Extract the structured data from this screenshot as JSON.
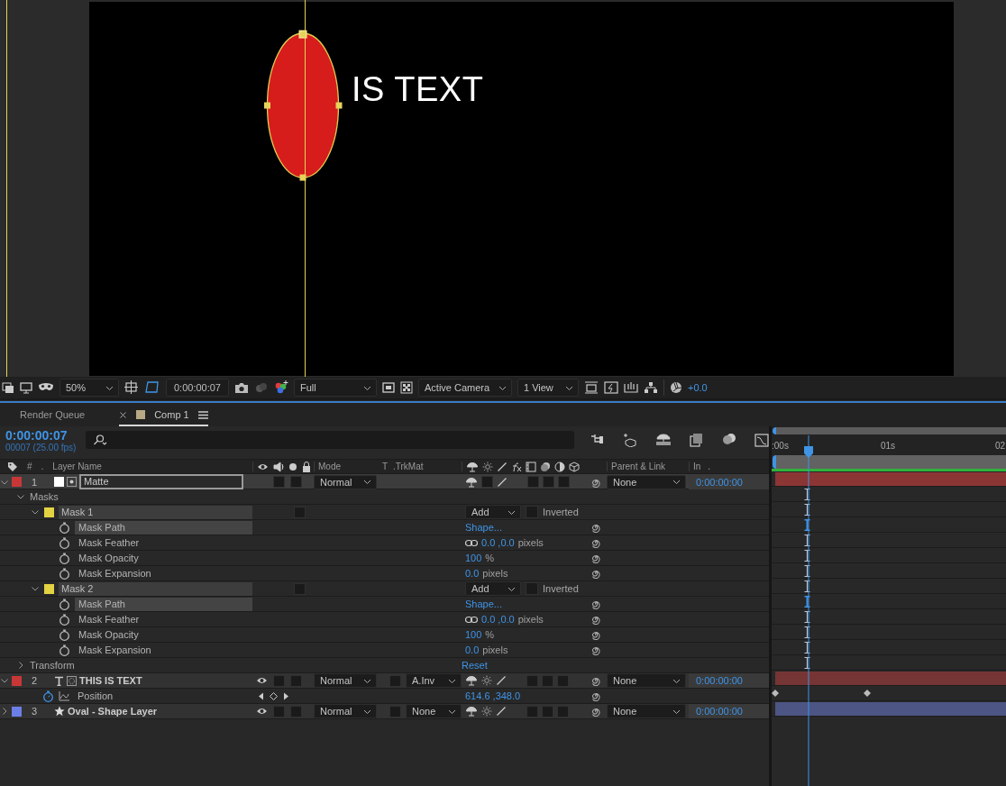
{
  "viewer": {
    "comp_text": "IS TEXT",
    "zoom": "50%",
    "timecode": "0:00:00:07",
    "resolution": "Full",
    "camera": "Active Camera",
    "views": "1 View",
    "exposure": "+0.0"
  },
  "tabs": [
    {
      "label": "Render Queue",
      "selected": false,
      "closable": false
    },
    {
      "label": "Comp 1",
      "selected": true,
      "closable": true,
      "color": "#b9a886"
    }
  ],
  "timeline": {
    "current_time": "0:00:00:07",
    "frame_info": "00007 (25.00 fps)",
    "ruler": [
      ":00s",
      "01s",
      "02"
    ],
    "columns": {
      "number": "#",
      "dot": ".",
      "layer_name": "Layer Name",
      "mode": "Mode",
      "t": "T",
      "trkmat": ".TrkMat",
      "parent": "Parent & Link",
      "in": "In",
      "in_dot": "."
    },
    "layers": [
      {
        "number": "1",
        "name": "Matte",
        "kind": "solid",
        "color": "#c83737",
        "selected": true,
        "expanded": true,
        "visible": false,
        "mode": "Normal",
        "parent": "None",
        "in": "0:00:00:00",
        "children": [
          {
            "kind": "group",
            "name": "Masks",
            "expanded": true,
            "children": [
              {
                "kind": "mask",
                "name": "Mask 1",
                "color": "#e3d343",
                "expanded": true,
                "mode": "Add",
                "inverted": false,
                "inverted_label": "Inverted",
                "children": [
                  {
                    "kind": "property",
                    "name": "Mask Path",
                    "selected": true,
                    "animated": false,
                    "value": "Shape..."
                  },
                  {
                    "kind": "property",
                    "name": "Mask Feather",
                    "selected": false,
                    "animated": false,
                    "linked": true,
                    "value": "0.0 ,0.0",
                    "unit": "pixels"
                  },
                  {
                    "kind": "property",
                    "name": "Mask Opacity",
                    "selected": false,
                    "animated": false,
                    "value": "100",
                    "unit": "%"
                  },
                  {
                    "kind": "property",
                    "name": "Mask Expansion",
                    "selected": false,
                    "animated": false,
                    "value": "0.0",
                    "unit": "pixels"
                  }
                ]
              },
              {
                "kind": "mask",
                "name": "Mask 2",
                "color": "#e3d343",
                "expanded": true,
                "mode": "Add",
                "inverted": false,
                "inverted_label": "Inverted",
                "children": [
                  {
                    "kind": "property",
                    "name": "Mask Path",
                    "selected": true,
                    "animated": false,
                    "value": "Shape..."
                  },
                  {
                    "kind": "property",
                    "name": "Mask Feather",
                    "selected": false,
                    "animated": false,
                    "linked": true,
                    "value": "0.0 ,0.0",
                    "unit": "pixels"
                  },
                  {
                    "kind": "property",
                    "name": "Mask Opacity",
                    "selected": false,
                    "animated": false,
                    "value": "100",
                    "unit": "%"
                  },
                  {
                    "kind": "property",
                    "name": "Mask Expansion",
                    "selected": false,
                    "animated": false,
                    "value": "0.0",
                    "unit": "pixels"
                  }
                ]
              }
            ]
          },
          {
            "kind": "group",
            "name": "Transform",
            "expanded": false,
            "value": "Reset"
          }
        ]
      },
      {
        "number": "2",
        "name": "THIS IS TEXT",
        "kind": "text",
        "color": "#c83737",
        "selected": false,
        "expanded": true,
        "visible": true,
        "mode": "Normal",
        "trkmat": "A.Inv",
        "parent": "None",
        "in": "0:00:00:00",
        "children": [
          {
            "kind": "property",
            "name": "Position",
            "selected": false,
            "animated": true,
            "value": "614.6 ,348.0"
          }
        ]
      },
      {
        "number": "3",
        "name": "Oval - Shape Layer",
        "kind": "shape",
        "color": "#6b7fe6",
        "selected": false,
        "expanded": false,
        "visible": true,
        "mode": "Normal",
        "trkmat": "None",
        "parent": "None",
        "in": "0:00:00:00"
      }
    ]
  }
}
